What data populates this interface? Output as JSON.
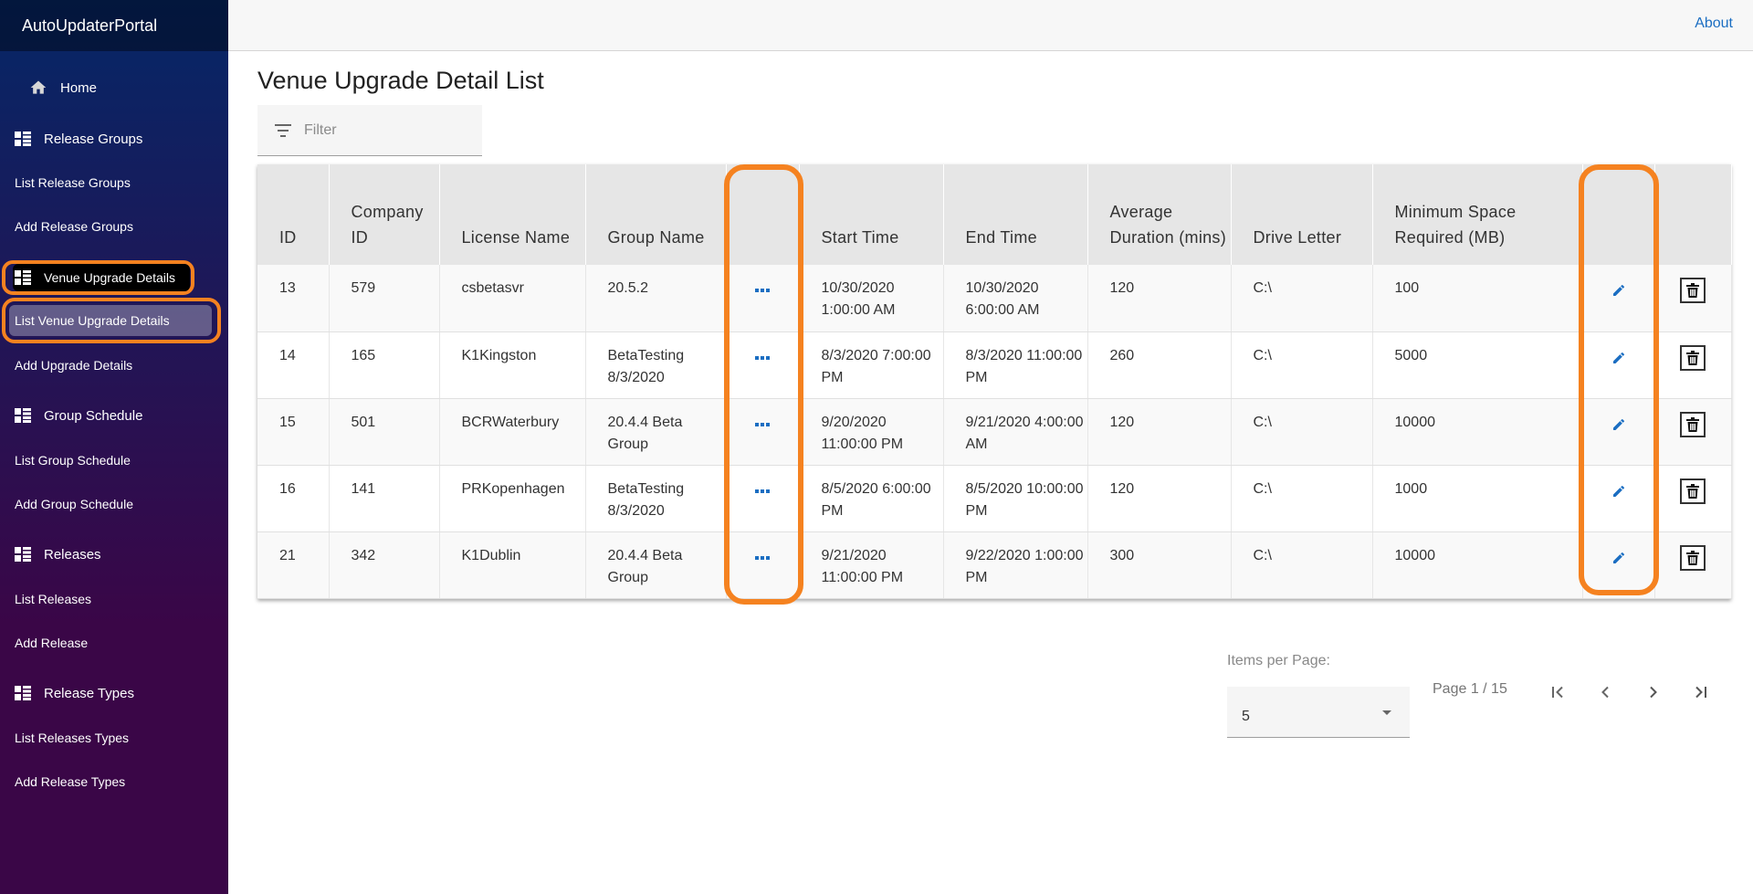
{
  "app": {
    "brand": "AutoUpdaterPortal",
    "about_link": "About"
  },
  "sidebar": {
    "home": "Home",
    "sections": [
      {
        "label": "Release Groups",
        "items": [
          "List Release Groups",
          "Add Release Groups"
        ]
      },
      {
        "label": "Venue Upgrade Details",
        "items": [
          "List Venue Upgrade Details",
          "Add Upgrade Details"
        ]
      },
      {
        "label": "Group Schedule",
        "items": [
          "List Group Schedule",
          "Add Group Schedule"
        ]
      },
      {
        "label": "Releases",
        "items": [
          "List Releases",
          "Add Release"
        ]
      },
      {
        "label": "Release Types",
        "items": [
          "List Releases Types",
          "Add Release Types"
        ]
      }
    ],
    "active_section": "Venue Upgrade Details",
    "active_item": "List Venue Upgrade Details"
  },
  "main": {
    "title": "Venue Upgrade Detail List",
    "filter_placeholder": "Filter",
    "columns": [
      "ID",
      "Company ID",
      "License Name",
      "Group Name",
      "",
      "Start Time",
      "End Time",
      "Average Duration (mins)",
      "Drive Letter",
      "Minimum Space Required (MB)",
      "",
      ""
    ],
    "rows": [
      [
        "13",
        "579",
        "csbetasvr",
        "20.5.2",
        "10/30/2020 1:00:00 AM",
        "10/30/2020 6:00:00 AM",
        "120",
        "C:\\",
        "100"
      ],
      [
        "14",
        "165",
        "K1Kingston",
        "BetaTesting 8/3/2020",
        "8/3/2020 7:00:00 PM",
        "8/3/2020 11:00:00 PM",
        "260",
        "C:\\",
        "5000"
      ],
      [
        "15",
        "501",
        "BCRWaterbury",
        "20.4.4 Beta Group",
        "9/20/2020 11:00:00 PM",
        "9/21/2020 4:00:00 AM",
        "120",
        "C:\\",
        "10000"
      ],
      [
        "16",
        "141",
        "PRKopenhagen",
        "BetaTesting 8/3/2020",
        "8/5/2020 6:00:00 PM",
        "8/5/2020 10:00:00 PM",
        "120",
        "C:\\",
        "1000"
      ],
      [
        "21",
        "342",
        "K1Dublin",
        "20.4.4 Beta Group",
        "9/21/2020 11:00:00 PM",
        "9/22/2020 1:00:00 PM",
        "300",
        "C:\\",
        "10000"
      ]
    ]
  },
  "pagination": {
    "items_per_page_label": "Items per Page:",
    "items_per_page": "5",
    "page_info": "Page 1 / 15"
  },
  "colors": {
    "highlight": "#f58220",
    "link": "#1b6ec2",
    "icon_blue": "#1b6ec2"
  },
  "icons": [
    "home-icon",
    "list-icon",
    "filter-icon",
    "more-dots-icon",
    "edit-pencil-icon",
    "trash-icon",
    "first-page-icon",
    "prev-page-icon",
    "next-page-icon",
    "last-page-icon"
  ]
}
